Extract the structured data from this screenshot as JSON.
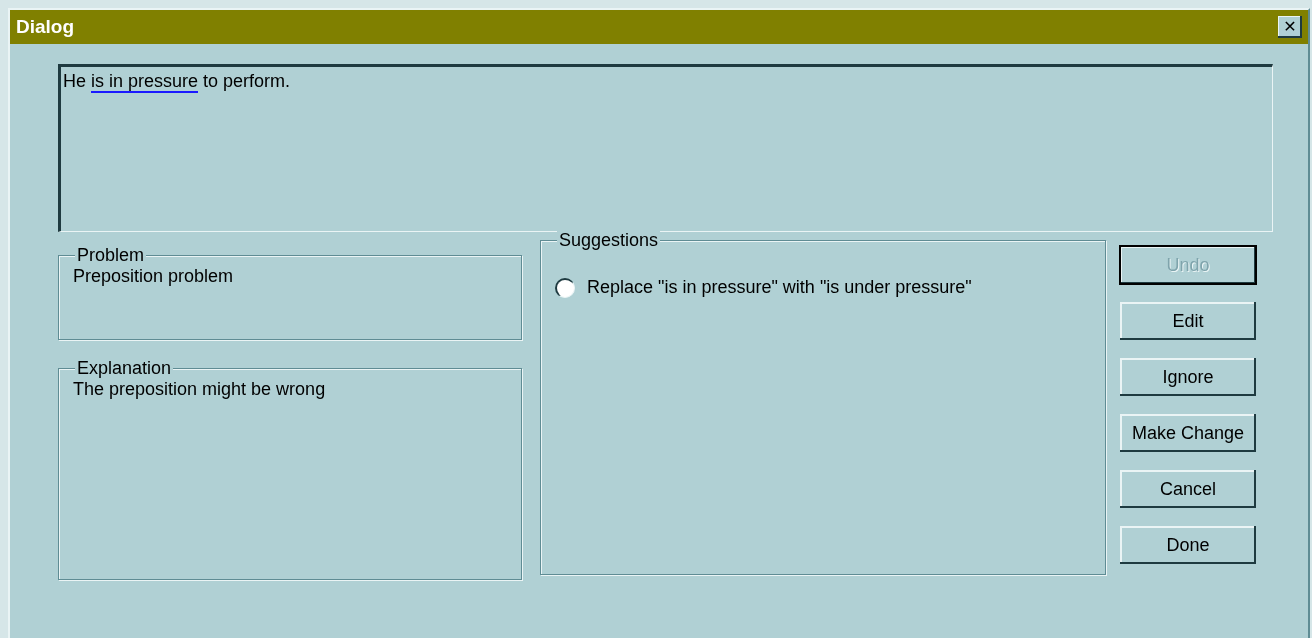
{
  "window": {
    "title": "Dialog",
    "close": "✕"
  },
  "text_area": {
    "before": "He ",
    "flagged": "is in pressure",
    "after": " to perform."
  },
  "problem": {
    "title": "Problem",
    "text": "Preposition problem"
  },
  "explanation": {
    "title": "Explanation",
    "text": "The preposition might be wrong"
  },
  "suggestions": {
    "title": "Suggestions",
    "items": [
      {
        "label": "Replace \"is in pressure\" with \"is under pressure\"",
        "checked": false
      }
    ]
  },
  "buttons": [
    {
      "label": "Undo",
      "disabled": true,
      "default": true
    },
    {
      "label": "Edit",
      "disabled": false,
      "default": false
    },
    {
      "label": "Ignore",
      "disabled": false,
      "default": false
    },
    {
      "label": "Make Change",
      "disabled": false,
      "default": false
    },
    {
      "label": "Cancel",
      "disabled": false,
      "default": false
    },
    {
      "label": "Done",
      "disabled": false,
      "default": false
    }
  ]
}
